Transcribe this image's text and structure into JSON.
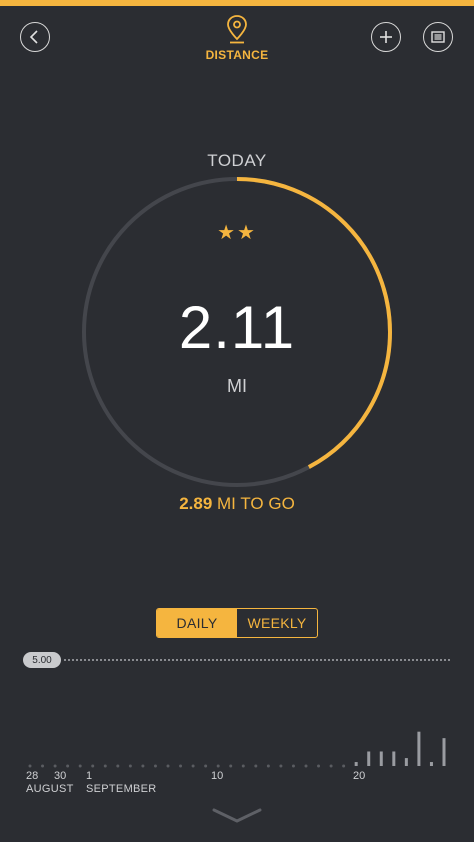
{
  "header": {
    "title": "DISTANCE",
    "back_icon": "chevron-left-icon",
    "add_icon": "plus-icon",
    "menu_icon": "list-icon"
  },
  "summary": {
    "period": "TODAY",
    "stars": "★★",
    "value": "2.11",
    "unit": "MI",
    "remaining_value": "2.89",
    "remaining_label": "MI TO GO",
    "goal_progress_fraction": 0.422
  },
  "toggle": {
    "daily": "DAILY",
    "weekly": "WEEKLY",
    "selected": "DAILY"
  },
  "chart_data": {
    "type": "bar",
    "goal_label": "5.00",
    "x_ticks": [
      "28",
      "30",
      "1",
      "10",
      "20"
    ],
    "month_labels": [
      "AUGUST",
      "SEPTEMBER"
    ],
    "values": [
      0,
      0,
      0,
      0,
      0,
      0,
      0,
      0,
      0,
      0,
      0,
      0,
      0,
      0,
      0,
      0,
      0,
      0,
      0,
      0,
      0,
      0,
      0,
      0,
      0,
      0,
      0.3,
      1.1,
      1.1,
      1.1,
      0.6,
      2.6,
      0.3,
      2.11
    ],
    "ylim": [
      0,
      5
    ],
    "colors": {
      "accent": "#f5b53f",
      "bar": "#9a9ca1",
      "dot": "#5a5c61"
    }
  },
  "footer": {
    "expand_icon": "chevron-down-icon"
  }
}
